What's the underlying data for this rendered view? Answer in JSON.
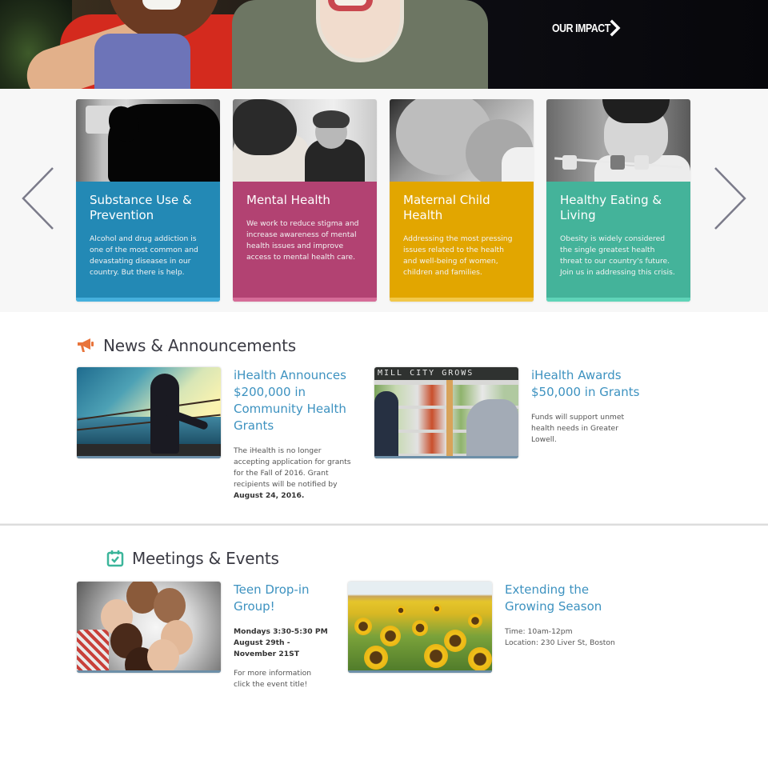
{
  "hero": {
    "cta_label": "OUR IMPACT",
    "cta_icon": "chevron-right-icon"
  },
  "carousel": {
    "prev_icon": "chevron-left-icon",
    "next_icon": "chevron-right-icon",
    "cards": [
      {
        "title": "Substance Use & Prevention",
        "description": "Alcohol and drug addiction is one of the most common and devastating diseases in our country. But there is help.",
        "color": "#2389b5",
        "accent_light": "#45b0dd"
      },
      {
        "title": "Mental Health",
        "description": "We work to reduce stigma and increase awareness of mental health issues and improve access to mental health care.",
        "color": "#b24272",
        "accent_light": "#d66c98"
      },
      {
        "title": "Maternal Child Health",
        "description": "Addressing the most pressing issues related to the health and well-being of women, children and families.",
        "color": "#e2a600",
        "accent_light": "#f2c84a"
      },
      {
        "title": "Healthy Eating & Living",
        "description": "Obesity is widely considered the single greatest health threat to our country's future. Join us in addressing this crisis.",
        "color": "#44b39a",
        "accent_light": "#5fd4b8"
      }
    ]
  },
  "news": {
    "heading": "News & Announcements",
    "icon": "megaphone-icon",
    "icon_color": "#e8743b",
    "items": [
      {
        "title": "iHealth Announces $200,000 in Community Health Grants",
        "description": "The iHealth is no longer accepting application for grants for the Fall of 2016. Grant recipients will be notified by",
        "description_bold": "August 24, 2016."
      },
      {
        "title": "iHealth Awards $50,000 in Grants",
        "description": "Funds will support unmet health needs in Greater Lowell.",
        "image_text": "MILL CITY GROWS"
      }
    ]
  },
  "events": {
    "heading": "Meetings & Events",
    "icon": "calendar-check-icon",
    "icon_color": "#3bb59a",
    "items": [
      {
        "title": "Teen Drop-in Group!",
        "schedule": "Mondays 3:30-5:30 PM August 29th - November 21ST",
        "description": "For more information click the event title!"
      },
      {
        "title": "Extending the Growing Season",
        "time": "Time: 10am-12pm",
        "location": "Location: 230 Liver St, Boston"
      }
    ]
  },
  "colors": {
    "link": "#3d92c0",
    "heading": "#3b3b44",
    "arrow": "#7b7b8a"
  }
}
